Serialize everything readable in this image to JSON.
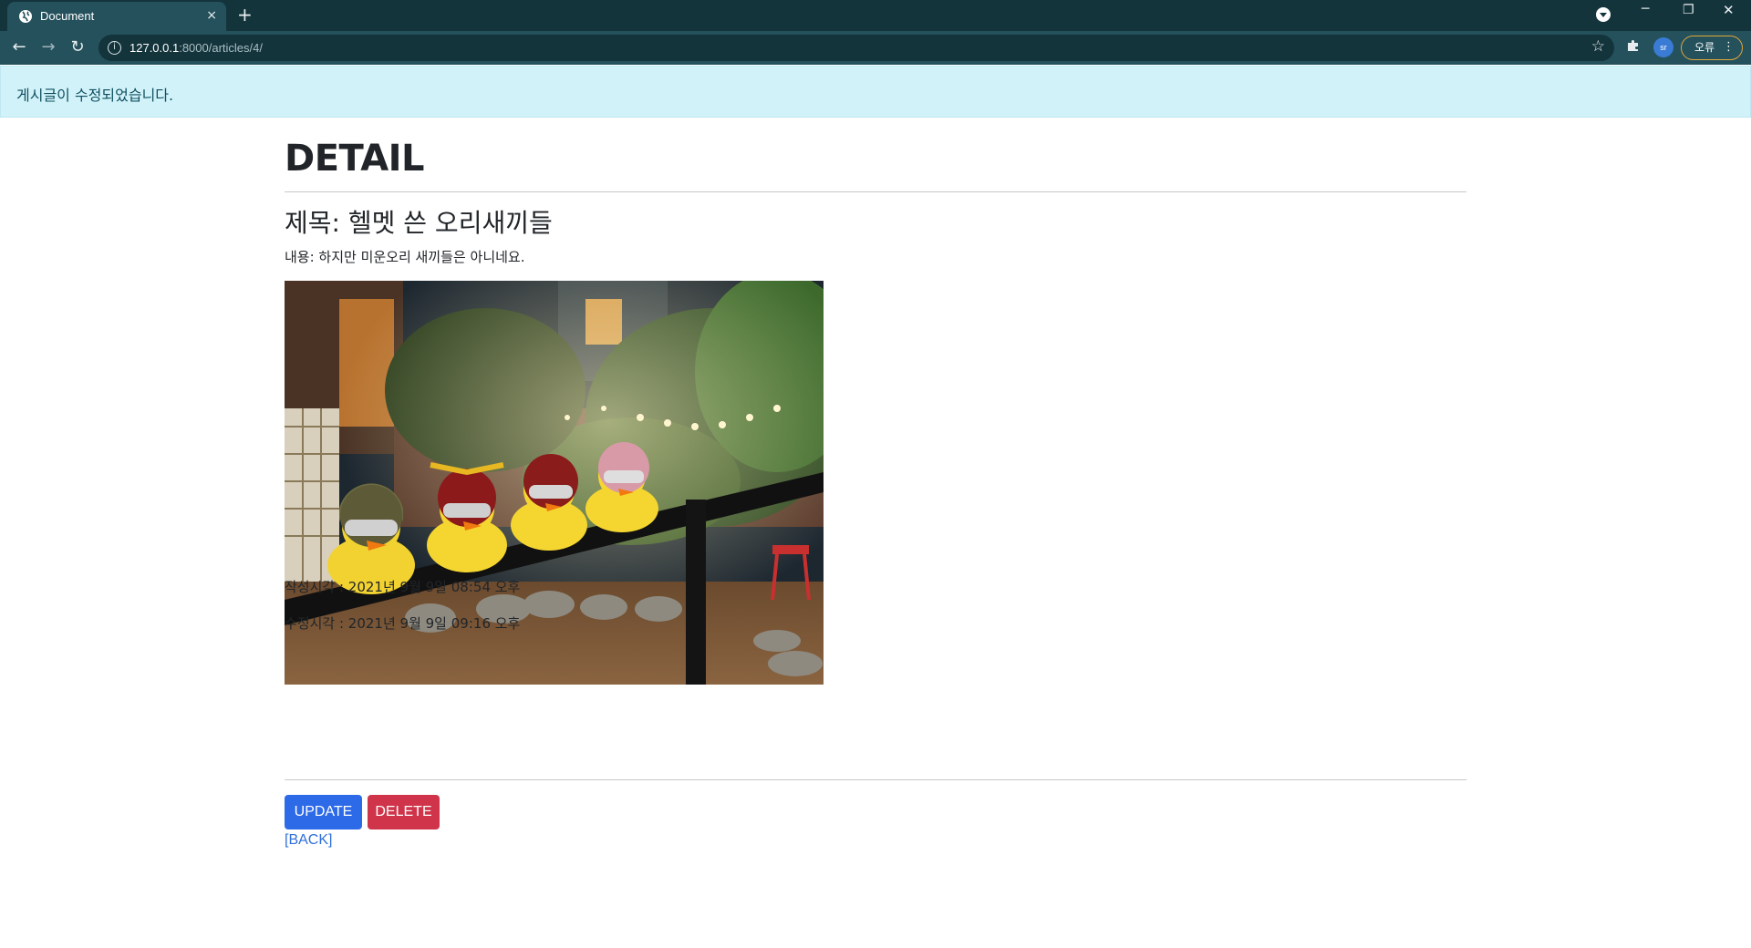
{
  "browser": {
    "tab_title": "Document",
    "tab_close": "×",
    "new_tab": "+",
    "url_host": "127.0.0.1",
    "url_rest": ":8000/articles/4/",
    "profile_initials": "sr",
    "error_label": "오류",
    "window_controls": {
      "minimize": "─",
      "restore": "❐",
      "close": "✕"
    }
  },
  "alert": {
    "message": "게시글이 수정되었습니다."
  },
  "page": {
    "heading": "DETAIL",
    "title": "제목: 헬멧 쓴 오리새끼들",
    "content": "내용: 하지만 미운오리 새끼들은 아니네요.",
    "created": "작성시각 : 2021년 9월 9일 08:54 오후",
    "updated": "수정시각 : 2021년 9월 9일 09:16 오후",
    "update_label": "UPDATE",
    "delete_label": "DELETE",
    "back_label": "[BACK]"
  },
  "colors": {
    "chrome_dark": "#14343c",
    "chrome_mid": "#24515c",
    "alert_bg": "#d1f2f9",
    "update_btn": "#2d6ae8",
    "delete_btn": "#d0344a",
    "link": "#2f6fd8"
  },
  "icons": [
    "globe-icon",
    "close-icon",
    "plus-icon",
    "back-arrow-icon",
    "forward-arrow-icon",
    "reload-icon",
    "info-icon",
    "star-icon",
    "puzzle-icon",
    "more-icon"
  ]
}
